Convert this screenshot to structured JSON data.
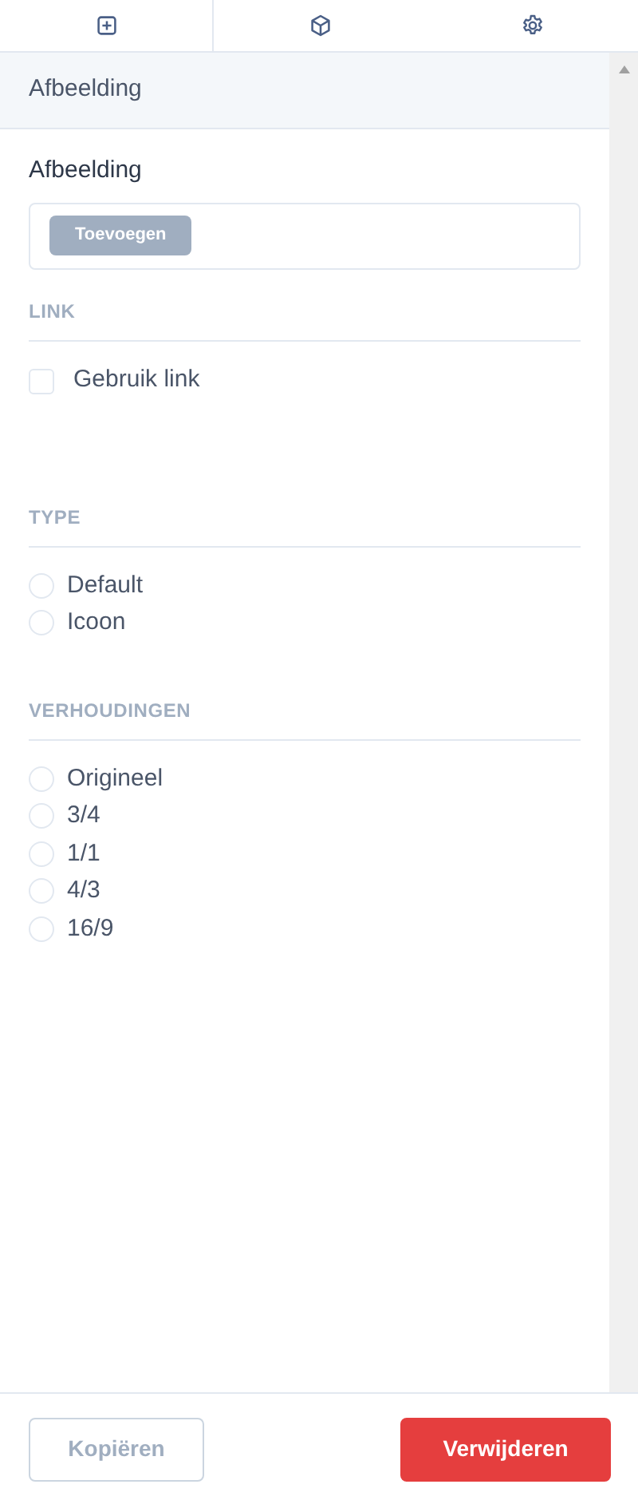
{
  "panel_title": "Afbeelding",
  "image_field": {
    "label": "Afbeelding",
    "button": "Toevoegen"
  },
  "sections": [
    {
      "title": "LINK",
      "kind": "checkbox",
      "options": [
        {
          "label": "Gebruik link",
          "checked": false
        }
      ]
    },
    {
      "title": "TYPE",
      "kind": "radio",
      "options": [
        {
          "label": "Default",
          "selected": false
        },
        {
          "label": "Icoon",
          "selected": false
        }
      ]
    },
    {
      "title": "VERHOUDINGEN",
      "kind": "radio",
      "options": [
        {
          "label": "Origineel",
          "selected": false
        },
        {
          "label": "3/4",
          "selected": false
        },
        {
          "label": "1/1",
          "selected": false
        },
        {
          "label": "4/3",
          "selected": false
        },
        {
          "label": "16/9",
          "selected": false
        }
      ]
    }
  ],
  "footer": {
    "copy_button": "Kopiëren",
    "delete_button": "Verwijderen"
  }
}
